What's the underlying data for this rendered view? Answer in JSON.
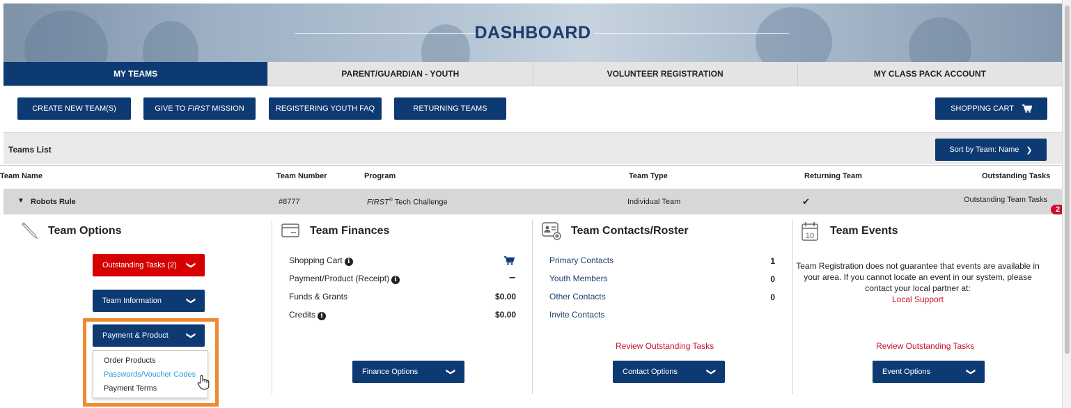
{
  "header": {
    "title": "DASHBOARD"
  },
  "tabs": [
    {
      "label": "MY TEAMS",
      "active": true
    },
    {
      "label": "PARENT/GUARDIAN - YOUTH",
      "active": false
    },
    {
      "label": "VOLUNTEER REGISTRATION",
      "active": false
    },
    {
      "label": "MY CLASS PACK ACCOUNT",
      "active": false
    }
  ],
  "actions": {
    "create": "CREATE NEW TEAM(S)",
    "give_pre": "GIVE TO",
    "give_em": "FIRST",
    "give_post": "MISSION",
    "faq": "REGISTERING YOUTH FAQ",
    "returning": "RETURNING TEAMS",
    "cart": "SHOPPING CART"
  },
  "teams_list": {
    "title": "Teams List",
    "sort_label": "Sort by Team: Name",
    "columns": {
      "name": "Team Name",
      "number": "Team Number",
      "program": "Program",
      "type": "Team Type",
      "returning": "Returning Team",
      "tasks": "Outstanding Tasks"
    },
    "row": {
      "name": "Robots Rule",
      "number": "#8777",
      "program_em": "FIRST",
      "program_sup": "®",
      "program_rest": " Tech Challenge",
      "type": "Individual Team",
      "returning": "✔",
      "tasks_label": "Outstanding Team Tasks",
      "tasks_count": "2"
    }
  },
  "team_options": {
    "title": "Team Options",
    "outstanding": "Outstanding Tasks (2)",
    "info": "Team Information",
    "payment": "Payment & Product",
    "menu": [
      "Order Products",
      "Passwords/Voucher Codes",
      "Payment Terms"
    ]
  },
  "finances": {
    "title": "Team Finances",
    "rows": [
      {
        "label": "Shopping Cart",
        "value": ""
      },
      {
        "label": "Payment/Product (Receipt)",
        "value": "–"
      },
      {
        "label": "Funds & Grants",
        "value": "$0.00"
      },
      {
        "label": "Credits",
        "value": "$0.00"
      }
    ],
    "button": "Finance Options"
  },
  "contacts": {
    "title": "Team Contacts/Roster",
    "rows": [
      {
        "label": "Primary Contacts",
        "value": "1"
      },
      {
        "label": "Youth Members",
        "value": "0"
      },
      {
        "label": "Other Contacts",
        "value": "0"
      },
      {
        "label": "Invite Contacts",
        "value": ""
      }
    ],
    "review": "Review Outstanding Tasks",
    "button": "Contact Options"
  },
  "events": {
    "title": "Team Events",
    "calendar_day": "10",
    "text": "Team Registration does not guarantee that events are available in your area. If you cannot locate an event in our system, please contact your local partner at:",
    "support": "Local Support",
    "review": "Review Outstanding Tasks",
    "button": "Event Options"
  }
}
